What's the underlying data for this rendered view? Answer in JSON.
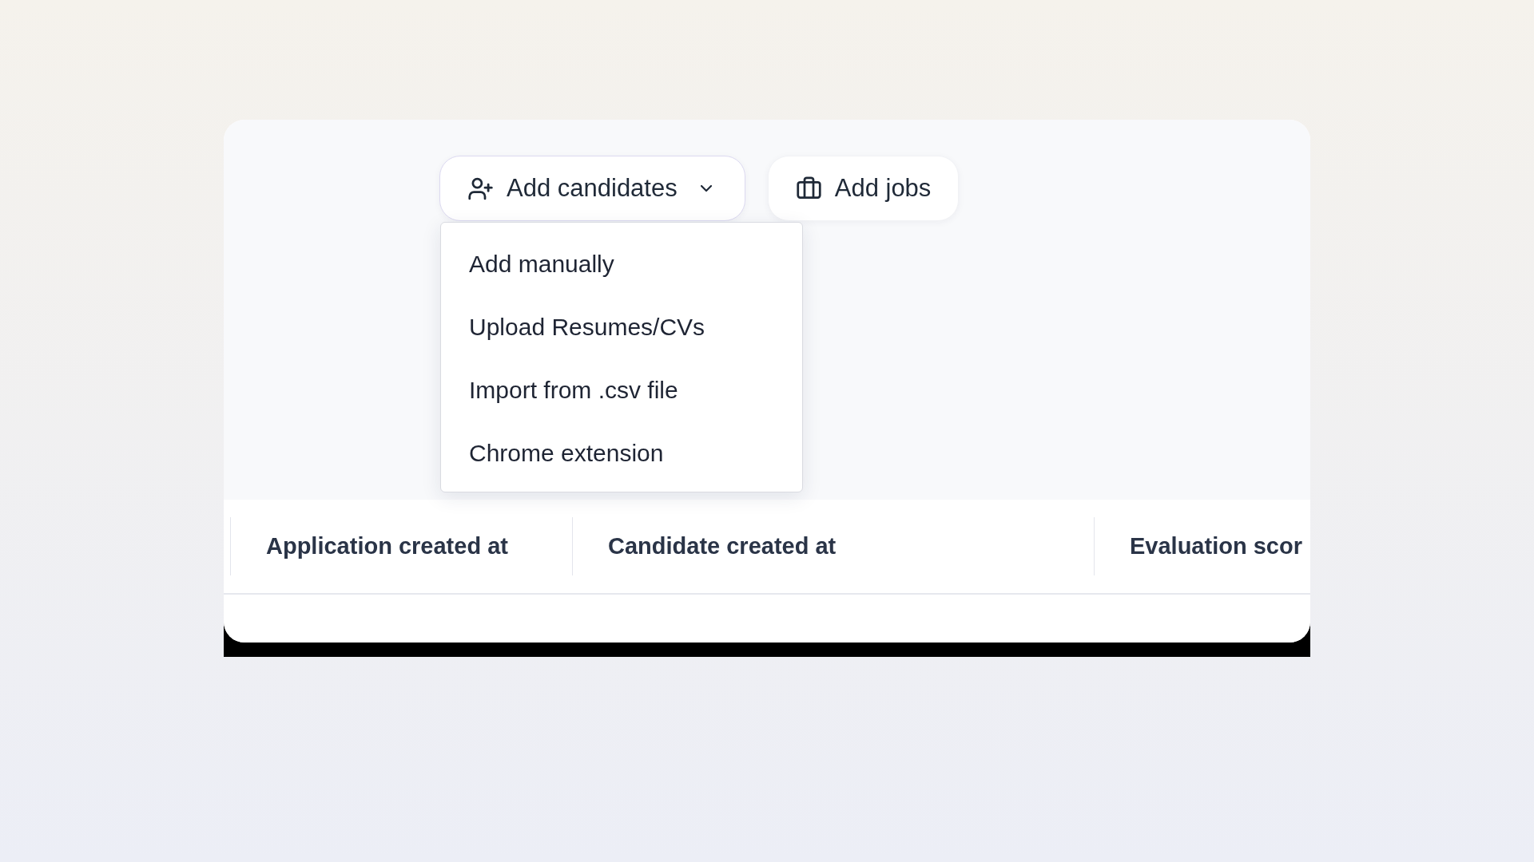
{
  "toolbar": {
    "buttons": [
      {
        "label": "Add candidates",
        "kind": "dropdown",
        "expanded": true
      },
      {
        "label": "Add jobs",
        "kind": "plain"
      }
    ]
  },
  "menu": {
    "items": [
      "Add manually",
      "Upload Resumes/CVs",
      "Import from .csv file",
      "Chrome extension"
    ]
  },
  "table": {
    "columns": [
      "Application created at",
      "Candidate created at",
      "Evaluation scor"
    ]
  }
}
